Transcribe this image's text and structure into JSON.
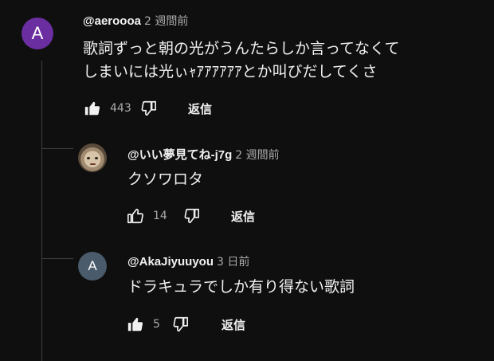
{
  "comments": [
    {
      "avatar_letter": "A",
      "avatar_color": "#6a2ea0",
      "author": "@aeroooa",
      "time": "2 週間前",
      "text_line1": "歌詞ずっと朝の光がうんたらしか言ってなくて",
      "text_line2": "しまいには光ぃｬｱｱｱｱｱｱとか叫びだしてくさ",
      "likes": "443",
      "liked": true,
      "reply_label": "返信"
    },
    {
      "avatar_type": "photo",
      "author": "@いい夢見てね-j7g",
      "time": "2 週間前",
      "text": "クソワロタ",
      "likes": "14",
      "liked": false,
      "reply_label": "返信"
    },
    {
      "avatar_letter": "A",
      "avatar_color": "#4a5b6b",
      "author": "@AkaJiyuuyou",
      "time": "3 日前",
      "text": "ドラキュラでしか有り得ない歌詞",
      "likes": "5",
      "liked": true,
      "reply_label": "返信"
    }
  ],
  "colors": {
    "background": "#0f0f0f",
    "text": "#f1f1f1",
    "muted": "#aaaaaa"
  },
  "icons": [
    "thumb-up-icon",
    "thumb-down-icon"
  ]
}
